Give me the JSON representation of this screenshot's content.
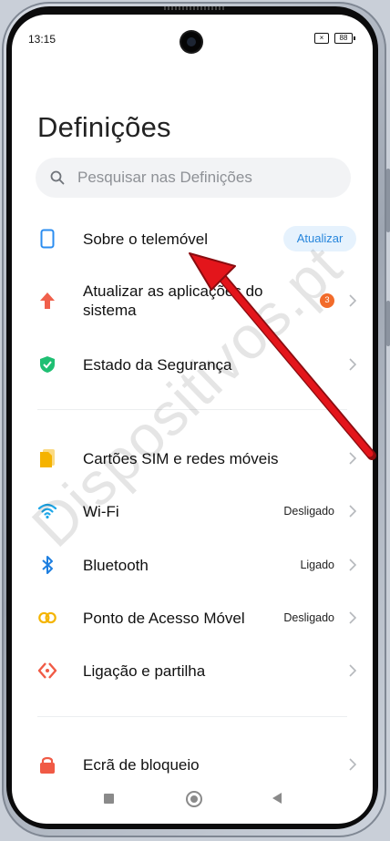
{
  "status_bar": {
    "time": "13:15",
    "battery": "88"
  },
  "title": "Definições",
  "search": {
    "placeholder": "Pesquisar nas Definições"
  },
  "items": [
    {
      "label": "Sobre o telemóvel",
      "action": "Atualizar",
      "icon": "phone-icon"
    },
    {
      "label_line1": "Atualizar as aplicações do",
      "label_line2": "sistema",
      "badge": "3",
      "icon": "arrow-up-icon"
    },
    {
      "label": "Estado da Segurança",
      "icon": "shield-icon"
    },
    {
      "label": "Cartões SIM e redes móveis",
      "icon": "sim-card-icon"
    },
    {
      "label": "Wi-Fi",
      "value": "Desligado",
      "icon": "wifi-icon"
    },
    {
      "label": "Bluetooth",
      "value": "Ligado",
      "icon": "bluetooth-icon"
    },
    {
      "label": "Ponto de Acesso Móvel",
      "value": "Desligado",
      "icon": "hotspot-icon"
    },
    {
      "label": "Ligação e partilha",
      "icon": "connection-sharing-icon"
    },
    {
      "label": "Ecrã de bloqueio",
      "icon": "lock-icon"
    }
  ],
  "watermark": "Dispositivos.pt",
  "colors": {
    "accent": "#2786dc",
    "badge": "#f26b2a",
    "arrow": "#e3151b"
  }
}
